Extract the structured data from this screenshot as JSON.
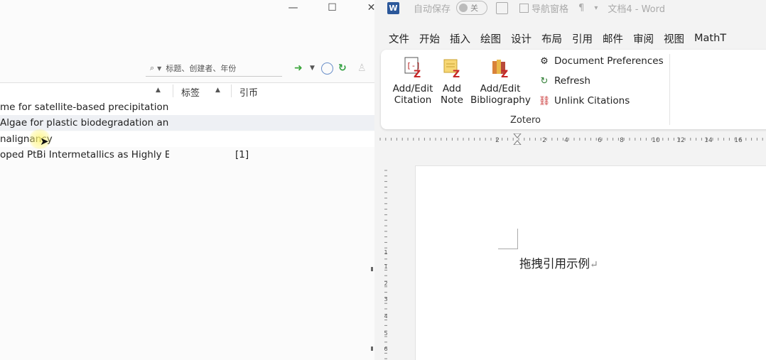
{
  "zotero": {
    "window_controls": {
      "minimize": "—",
      "maximize": "☐",
      "close": "✕"
    },
    "search": {
      "placeholder": "标题、创建者、年份"
    },
    "columns": {
      "tags": "标签",
      "cite": "引币"
    },
    "rows": [
      {
        "title": "me for satellite-based precipitation ...",
        "cite": ""
      },
      {
        "title": "Algae for plastic biodegradation an...",
        "cite": ""
      },
      {
        "title": "nalignancy",
        "cite": ""
      },
      {
        "title": "oped PtBi Intermetallics as Highly E...",
        "cite": "[1]"
      }
    ]
  },
  "word": {
    "title_bar": {
      "logo": "W",
      "autosave": "自动保存",
      "autosave_state": "关",
      "nav_pane": "导航窗格",
      "doc_title": "文档4 - Word"
    },
    "tabs": [
      "文件",
      "开始",
      "插入",
      "绘图",
      "设计",
      "布局",
      "引用",
      "邮件",
      "审阅",
      "视图",
      "MathT"
    ],
    "zotero_group": {
      "label": "Zotero",
      "add_edit_citation": [
        "Add/Edit",
        "Citation"
      ],
      "add_note": [
        "Add",
        "Note"
      ],
      "add_edit_bibliography": [
        "Add/Edit",
        "Bibliography"
      ],
      "document_preferences": "Document Preferences",
      "refresh": "Refresh",
      "unlink_citations": "Unlink Citations"
    },
    "ruler_numbers": [
      "2",
      "2",
      "4",
      "6",
      "8",
      "10",
      "12",
      "14",
      "16"
    ],
    "ruler_v_numbers": [
      "1",
      "1",
      "2",
      "3",
      "4",
      "5",
      "6"
    ],
    "document": {
      "text": "拖拽引用示例",
      "para_mark": "↵"
    }
  }
}
